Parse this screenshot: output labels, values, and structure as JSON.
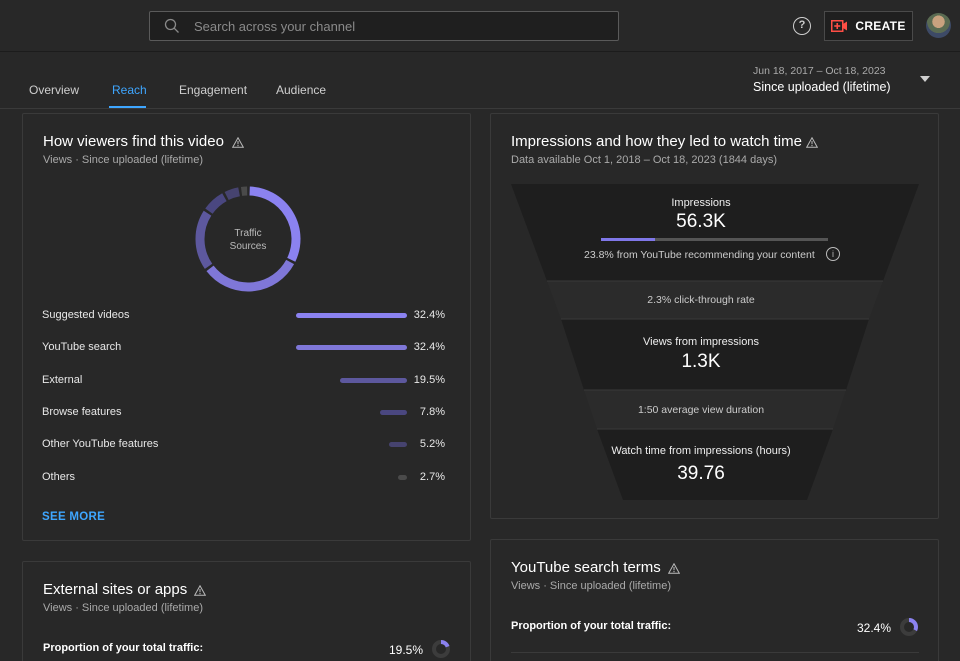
{
  "header": {
    "search_placeholder": "Search across your channel",
    "help_label": "?",
    "create_label": "CREATE"
  },
  "tabs": [
    {
      "label": "Overview",
      "active": false
    },
    {
      "label": "Reach",
      "active": true
    },
    {
      "label": "Engagement",
      "active": false
    },
    {
      "label": "Audience",
      "active": false
    }
  ],
  "date": {
    "range": "Jun 18, 2017 – Oct 18, 2023",
    "label": "Since uploaded (lifetime)"
  },
  "traffic_card": {
    "title": "How viewers find this video",
    "subtitle": "Views · Since uploaded (lifetime)",
    "donut_label_line1": "Traffic",
    "donut_label_line2": "Sources",
    "sources": [
      {
        "label": "Suggested videos",
        "value": "32.4%",
        "pct": 32.4
      },
      {
        "label": "YouTube search",
        "value": "32.4%",
        "pct": 32.4
      },
      {
        "label": "External",
        "value": "19.5%",
        "pct": 19.5
      },
      {
        "label": "Browse features",
        "value": "7.8%",
        "pct": 7.8
      },
      {
        "label": "Other YouTube features",
        "value": "5.2%",
        "pct": 5.2
      },
      {
        "label": "Others",
        "value": "2.7%",
        "pct": 2.7
      }
    ],
    "see_more": "SEE MORE"
  },
  "impressions_card": {
    "title": "Impressions and how they led to watch time",
    "subtitle": "Data available Oct 1, 2018 – Oct 18, 2023 (1844 days)",
    "impressions_label": "Impressions",
    "impressions_value": "56.3K",
    "recommend_pct": 23.8,
    "recommend_text": "23.8% from YouTube recommending your content",
    "ctr_text": "2.3% click-through rate",
    "views_label": "Views from impressions",
    "views_value": "1.3K",
    "avd_text": "1:50 average view duration",
    "watch_label": "Watch time from impressions (hours)",
    "watch_value": "39.76"
  },
  "external_card": {
    "title": "External sites or apps",
    "subtitle": "Views · Since uploaded (lifetime)",
    "prop_label": "Proportion of your total traffic:",
    "prop_value": "19.5%"
  },
  "search_terms_card": {
    "title": "YouTube search terms",
    "subtitle": "Views · Since uploaded (lifetime)",
    "prop_label": "Proportion of your total traffic:",
    "prop_value": "32.4%"
  },
  "colors": {
    "accent_blue": "#3ea6ff",
    "purple_strong": "#8b82f0",
    "purple_mid": "#7f77d8",
    "purple_dim": "#5d589e",
    "purple_faint": "#4a4780",
    "red": "#ff4e45"
  }
}
